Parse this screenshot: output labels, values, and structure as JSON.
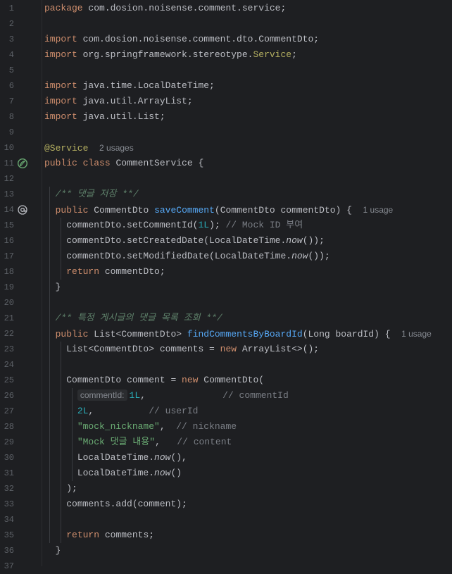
{
  "editor": {
    "lines": [
      {
        "n": "1",
        "segs": [
          [
            "kw",
            "package"
          ],
          [
            "",
            "com.dosion.noisense.comment.service;"
          ]
        ]
      },
      {
        "n": "2",
        "segs": []
      },
      {
        "n": "3",
        "segs": [
          [
            "kw",
            "import"
          ],
          [
            "",
            "com.dosion.noisense.comment.dto.CommentDto;"
          ]
        ]
      },
      {
        "n": "4",
        "segs": [
          [
            "kw",
            "import"
          ],
          [
            "",
            "org.springframework.stereotype."
          ],
          [
            "ann",
            "Service"
          ],
          [
            "",
            ";"
          ]
        ]
      },
      {
        "n": "5",
        "segs": []
      },
      {
        "n": "6",
        "segs": [
          [
            "kw",
            "import"
          ],
          [
            "",
            "java.time.LocalDateTime;"
          ]
        ]
      },
      {
        "n": "7",
        "segs": [
          [
            "kw",
            "import"
          ],
          [
            "",
            "java.util.ArrayList;"
          ]
        ]
      },
      {
        "n": "8",
        "segs": [
          [
            "kw",
            "import"
          ],
          [
            "",
            "java.util.List;"
          ]
        ]
      },
      {
        "n": "9",
        "segs": []
      },
      {
        "n": "10",
        "segs": [
          [
            "ann",
            "@Service"
          ],
          [
            "",
            "  "
          ],
          [
            "hint",
            "2 usages"
          ]
        ]
      },
      {
        "n": "11",
        "icon": "bean",
        "segs": [
          [
            "kw",
            "public class"
          ],
          [
            "",
            "CommentService {"
          ]
        ]
      },
      {
        "n": "12",
        "segs": []
      },
      {
        "n": "13",
        "indent": "  ",
        "segs": [
          [
            "doc",
            "/** 댓글 저장 **/"
          ]
        ]
      },
      {
        "n": "14",
        "icon": "at",
        "indent": "  ",
        "segs": [
          [
            "kw",
            "public"
          ],
          [
            "",
            "CommentDto "
          ],
          [
            "fn",
            "saveComment"
          ],
          [
            "",
            "(CommentDto commentDto) {  "
          ],
          [
            "hint",
            "1 usage"
          ]
        ]
      },
      {
        "n": "15",
        "indent": "    ",
        "segs": [
          [
            "",
            "commentDto.setCommentId("
          ],
          [
            "num",
            "1L"
          ],
          [
            "",
            "); "
          ],
          [
            "cm",
            "// Mock ID 부여"
          ]
        ]
      },
      {
        "n": "16",
        "indent": "    ",
        "segs": [
          [
            "",
            "commentDto.setCreatedDate(LocalDateTime."
          ],
          [
            "stat",
            "now"
          ],
          [
            "",
            "());"
          ]
        ]
      },
      {
        "n": "17",
        "indent": "    ",
        "segs": [
          [
            "",
            "commentDto.setModifiedDate(LocalDateTime."
          ],
          [
            "stat",
            "now"
          ],
          [
            "",
            "());"
          ]
        ]
      },
      {
        "n": "18",
        "indent": "    ",
        "segs": [
          [
            "kw",
            "return"
          ],
          [
            "",
            "commentDto;"
          ]
        ]
      },
      {
        "n": "19",
        "indent": "  ",
        "segs": [
          [
            "",
            "}"
          ]
        ]
      },
      {
        "n": "20",
        "segs": []
      },
      {
        "n": "21",
        "indent": "  ",
        "segs": [
          [
            "doc",
            "/** 특정 게시글의 댓글 목록 조회 **/"
          ]
        ]
      },
      {
        "n": "22",
        "indent": "  ",
        "segs": [
          [
            "kw",
            "public"
          ],
          [
            "",
            "List<CommentDto> "
          ],
          [
            "fn",
            "findCommentsByBoardId"
          ],
          [
            "",
            "(Long boardId) {  "
          ],
          [
            "hint",
            "1 usage"
          ]
        ]
      },
      {
        "n": "23",
        "indent": "    ",
        "segs": [
          [
            "",
            "List<CommentDto> comments = "
          ],
          [
            "kw",
            "new"
          ],
          [
            "",
            "ArrayList<>();"
          ]
        ]
      },
      {
        "n": "24",
        "segs": []
      },
      {
        "n": "25",
        "indent": "    ",
        "segs": [
          [
            "",
            "CommentDto comment = "
          ],
          [
            "kw",
            "new"
          ],
          [
            "",
            "CommentDto("
          ]
        ]
      },
      {
        "n": "26",
        "indent": "      ",
        "segs": [
          [
            "inlay",
            "commentId:"
          ],
          [
            "num",
            "1L"
          ],
          [
            "",
            ",              "
          ],
          [
            "cm",
            "// commentId"
          ]
        ]
      },
      {
        "n": "27",
        "indent": "      ",
        "segs": [
          [
            "num",
            "2L"
          ],
          [
            "",
            ",          "
          ],
          [
            "cm",
            "// userId"
          ]
        ]
      },
      {
        "n": "28",
        "indent": "      ",
        "segs": [
          [
            "str",
            "\"mock_nickname\""
          ],
          [
            "",
            ",  "
          ],
          [
            "cm",
            "// nickname"
          ]
        ]
      },
      {
        "n": "29",
        "indent": "      ",
        "segs": [
          [
            "str",
            "\"Mock 댓글 내용\""
          ],
          [
            "",
            ",   "
          ],
          [
            "cm",
            "// content"
          ]
        ]
      },
      {
        "n": "30",
        "indent": "      ",
        "segs": [
          [
            "",
            "LocalDateTime."
          ],
          [
            "stat",
            "now"
          ],
          [
            "",
            "(),"
          ]
        ]
      },
      {
        "n": "31",
        "indent": "      ",
        "segs": [
          [
            "",
            "LocalDateTime."
          ],
          [
            "stat",
            "now"
          ],
          [
            "",
            "()"
          ]
        ]
      },
      {
        "n": "32",
        "indent": "    ",
        "segs": [
          [
            "",
            ");"
          ]
        ]
      },
      {
        "n": "33",
        "indent": "    ",
        "segs": [
          [
            "",
            "comments.add(comment);"
          ]
        ]
      },
      {
        "n": "34",
        "segs": []
      },
      {
        "n": "35",
        "indent": "    ",
        "segs": [
          [
            "kw",
            "return"
          ],
          [
            "",
            "comments;"
          ]
        ]
      },
      {
        "n": "36",
        "indent": "  ",
        "segs": [
          [
            "",
            "}"
          ]
        ]
      },
      {
        "n": "37",
        "segs": []
      }
    ]
  },
  "icons": {
    "bean": "spring-bean-icon",
    "at": "override-at-icon"
  },
  "colors": {
    "background": "#1e1f22",
    "keyword": "#cf8e6d",
    "function": "#56a8f5",
    "number": "#2aacb8",
    "string": "#6aab73",
    "comment": "#7a7e85",
    "doc_comment": "#5f826b",
    "annotation": "#b3ae60",
    "text": "#bcbec4"
  }
}
